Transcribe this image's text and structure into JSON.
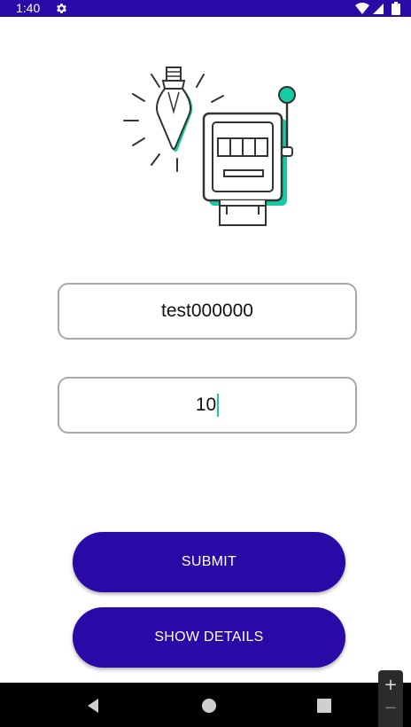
{
  "status_bar": {
    "time": "1:40",
    "background_color": "#2a0aa6",
    "icons": [
      "gear-icon",
      "wifi-icon",
      "signal-icon",
      "battery-icon"
    ]
  },
  "illustration": {
    "description_icon": "lightbulb-slot-machine-icon",
    "accent_color": "#18c9a6"
  },
  "form": {
    "username_value": "test000000",
    "number_value": "10"
  },
  "buttons": {
    "submit_label": "SUBMIT",
    "show_details_label": "SHOW DETAILS",
    "color": "#2a0aa6"
  },
  "nav_bar": {
    "icons": [
      "back-icon",
      "home-icon",
      "recents-icon"
    ]
  },
  "zoom": {
    "plus": "+",
    "minus": "−"
  }
}
